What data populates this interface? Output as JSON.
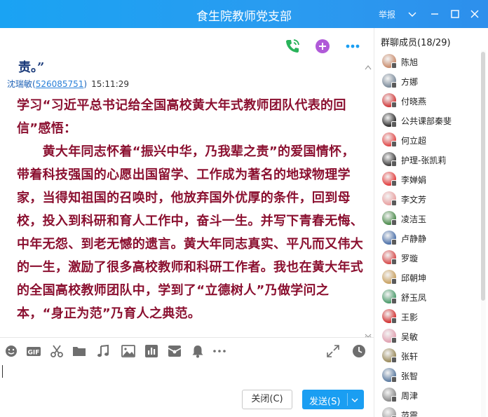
{
  "window": {
    "title": "食生院教师党支部",
    "report_label": "举报"
  },
  "chat": {
    "previous_message_tail": "责。”",
    "sender_name": "沈瑞敏",
    "sender_qq": "526085751",
    "time": "15:11:29",
    "message_paragraphs": [
      "学习“习近平总书记给全国高校黄大年式教师团队代表的回信”感悟：",
      "　　黄大年同志怀着“振兴中华，乃我辈之责”的爱国情怀，带着科技强国的心愿出国留学、工作成为著名的地球物理学家，当得知祖国的召唤时，他放弃国外优厚的条件，回到母校，投入到科研和育人工作中，奋斗一生。并写下青春无悔、中年无怨、到老无憾的遗言。黄大年同志真实、平凡而又伟大的一生，激励了很多高校教师和科研工作者。我也在黄大年式的全国高校教师团队中，学到了“立德树人”乃做学问之本，“身正为范”乃育人之典范。"
    ],
    "message_color": "#8b1030"
  },
  "buttons": {
    "close": "关闭(C)",
    "send": "发送(S)"
  },
  "members": {
    "title": "群聊成员(18/29)",
    "list": [
      {
        "name": "陈旭",
        "color": "#c98b6b"
      },
      {
        "name": "方娜",
        "color": "#7a8a9a"
      },
      {
        "name": "付晓燕",
        "color": "#d0393a"
      },
      {
        "name": "公共课部秦斐",
        "color": "#2c2c2c"
      },
      {
        "name": "何立超",
        "color": "#e04848"
      },
      {
        "name": "护理-张凯莉",
        "color": "#3b3b3b"
      },
      {
        "name": "李婵娟",
        "color": "#e23c3c"
      },
      {
        "name": "李文芳",
        "color": "#e8a0a0"
      },
      {
        "name": "凌洁玉",
        "color": "#4a8a4a"
      },
      {
        "name": "卢静静",
        "color": "#4a6fa8"
      },
      {
        "name": "罗璇",
        "color": "#d64a4a"
      },
      {
        "name": "邱朝坤",
        "color": "#c8a060"
      },
      {
        "name": "舒玉凤",
        "color": "#4a9a6a"
      },
      {
        "name": "王影",
        "color": "#d23030"
      },
      {
        "name": "吴敏",
        "color": "#e0a0b0"
      },
      {
        "name": "张轩",
        "color": "#9a8a5a"
      },
      {
        "name": "张智",
        "color": "#5a7aa0"
      },
      {
        "name": "周津",
        "color": "#8a8a8a"
      },
      {
        "name": "范震",
        "color": "#a0a0a0"
      }
    ]
  },
  "colors": {
    "titlebar": "#1aa3f3",
    "accent": "#1a9ef2"
  }
}
